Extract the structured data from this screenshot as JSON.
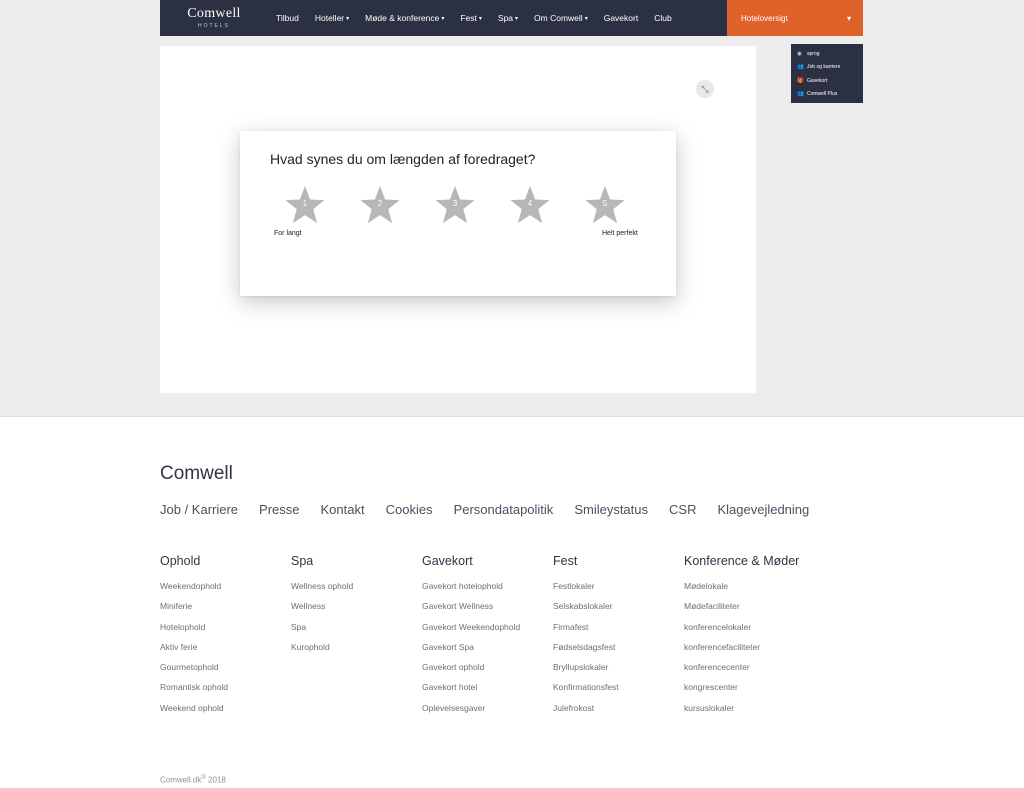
{
  "header": {
    "logo_name": "Comwell",
    "logo_sub": "HOTELS",
    "nav": [
      {
        "label": "Tilbud",
        "caret": ""
      },
      {
        "label": "Hoteller",
        "caret": "▾"
      },
      {
        "label": "Møde & konference",
        "caret": "▾"
      },
      {
        "label": "Fest",
        "caret": "▾"
      },
      {
        "label": "Spa",
        "caret": "▾"
      },
      {
        "label": "Om Comwell",
        "caret": "▾"
      },
      {
        "label": "Gavekort",
        "caret": ""
      },
      {
        "label": "Club",
        "caret": ""
      }
    ],
    "hotel_button": "Hoteloversigt",
    "hotel_caret": "▾",
    "accent_color": "#e0622b",
    "nav_bg": "#2b3142"
  },
  "util_menu": [
    {
      "icon": "globe-icon",
      "glyph": "◉",
      "label": "sprog"
    },
    {
      "icon": "users-icon",
      "glyph": "👥",
      "label": "Job og karriere"
    },
    {
      "icon": "gift-icon",
      "glyph": "🎁",
      "label": "Gavekort"
    },
    {
      "icon": "users-icon",
      "glyph": "👥",
      "label": "Comwell Plus"
    }
  ],
  "survey": {
    "question": "Hvad synes du om længden af foredraget?",
    "stars": [
      "1",
      "2",
      "3",
      "4",
      "5"
    ],
    "label_low": "For langt",
    "label_high": "Helt perfekt",
    "collapse_glyph": "⤡",
    "star_color": "#b7b7b7"
  },
  "footer": {
    "brand": "Comwell",
    "links": [
      "Job / Karriere",
      "Presse",
      "Kontakt",
      "Cookies",
      "Persondatapolitik",
      "Smileystatus",
      "CSR",
      "Klagevejledning"
    ],
    "columns": [
      {
        "title": "Ophold",
        "items": [
          "Weekendophold",
          "Miniferie",
          "Hotelophold",
          "Aktiv ferie",
          "Gourmetophold",
          "Romantisk ophold",
          "Weekend ophold"
        ]
      },
      {
        "title": "Spa",
        "items": [
          "Wellness ophold",
          "Wellness",
          "Spa",
          "Kurophold"
        ]
      },
      {
        "title": "Gavekort",
        "items": [
          "Gavekort hotelophold",
          "Gavekort Wellness",
          "Gavekort Weekendophold",
          "Gavekort Spa",
          "Gavekort ophold",
          "Gavekort hotel",
          "Oplevelsesgaver"
        ]
      },
      {
        "title": "Fest",
        "items": [
          "Festlokaler",
          "Selskabslokaler",
          "Firmafest",
          "Fødselsdagsfest",
          "Bryllupslokaler",
          "Konfirmationsfest",
          "Julefrokost"
        ]
      },
      {
        "title": "Konference & Møder",
        "items": [
          "Mødelokale",
          "Mødefaciliteter",
          "konferencelokaler",
          "konferencefaciliteter",
          "konferencecenter",
          "kongrescenter",
          "kursuslokaler"
        ]
      }
    ],
    "copyright": "Comwell.dk",
    "copyright_mark": "®",
    "year": "2018"
  }
}
